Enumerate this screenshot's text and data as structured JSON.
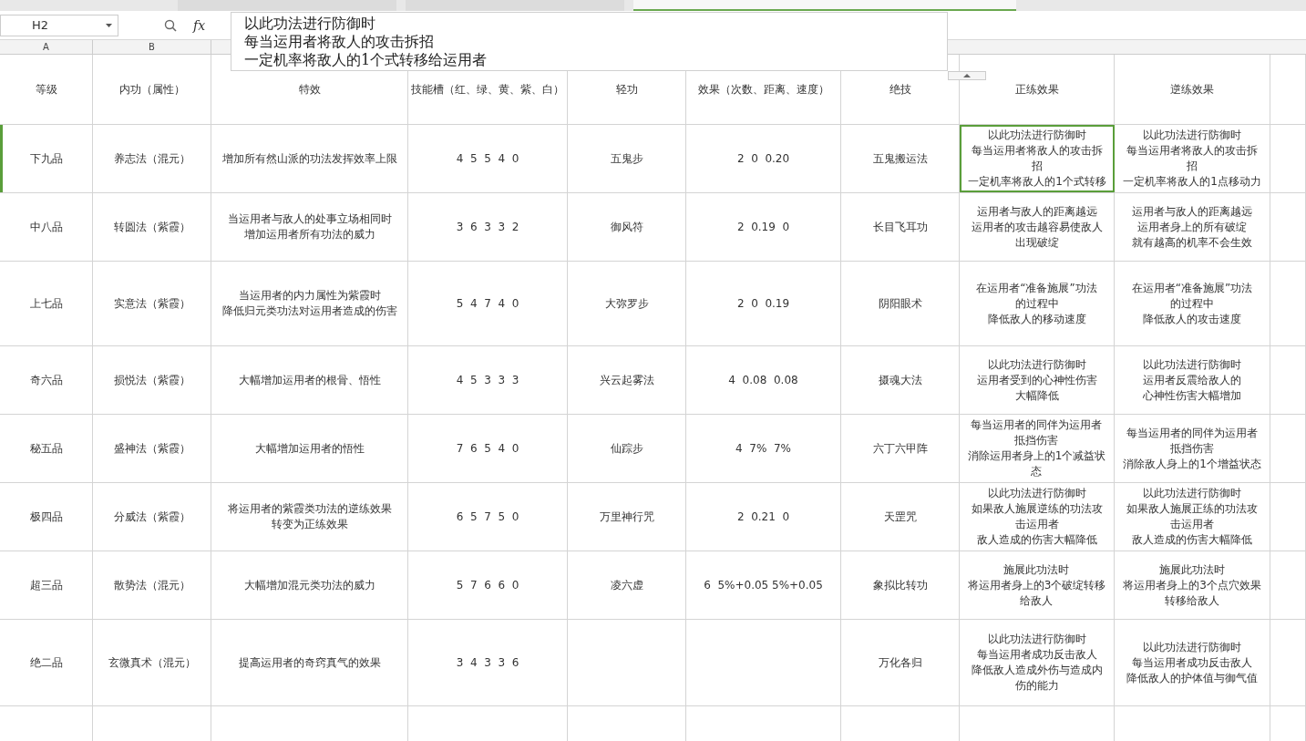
{
  "tabs": [
    {
      "selected": false
    },
    {
      "selected": false
    },
    {
      "selected": true
    }
  ],
  "formula_bar": {
    "cell_ref": "H2",
    "fx": "fx",
    "content": [
      "以此功法进行防御时",
      "每当运用者将敌人的攻击拆招",
      "一定机率将敌人的1个式转移给运用者"
    ]
  },
  "column_letters": [
    "A",
    "B"
  ],
  "headers": [
    "等级",
    "内功（属性）",
    "特效",
    "技能槽（红、绿、黄、紫、白）",
    "轻功",
    "效果（次数、距离、速度）",
    "绝技",
    "正练效果",
    "逆练效果"
  ],
  "rows": [
    {
      "selected": true,
      "cells": [
        {
          "lines": [
            "下九品"
          ],
          "selected": false
        },
        {
          "lines": [
            "养志法（混元）"
          ],
          "selected": false
        },
        {
          "lines": [
            "增加所有然山派的功法发挥效率上限"
          ],
          "selected": false
        },
        {
          "lines": [
            "4  5  5  4  0"
          ],
          "selected": false
        },
        {
          "lines": [
            "五鬼步"
          ],
          "selected": false
        },
        {
          "lines": [
            "2  0  0.20"
          ],
          "selected": false
        },
        {
          "lines": [
            "五鬼搬运法"
          ],
          "selected": false
        },
        {
          "lines": [
            "以此功法进行防御时",
            "每当运用者将敌人的攻击拆",
            "招",
            "一定机率将敌人的1个式转移"
          ],
          "selected": true
        },
        {
          "lines": [
            "以此功法进行防御时",
            "每当运用者将敌人的攻击拆",
            "招",
            "一定机率将敌人的1点移动力"
          ],
          "selected": false
        }
      ]
    },
    {
      "selected": false,
      "cells": [
        {
          "lines": [
            "中八品"
          ],
          "selected": false
        },
        {
          "lines": [
            "转圆法（紫霞）"
          ],
          "selected": false
        },
        {
          "lines": [
            "当运用者与敌人的处事立场相同时",
            "增加运用者所有功法的威力"
          ],
          "selected": false
        },
        {
          "lines": [
            "3  6  3  3  2"
          ],
          "selected": false
        },
        {
          "lines": [
            "御风符"
          ],
          "selected": false
        },
        {
          "lines": [
            "2  0.19  0"
          ],
          "selected": false
        },
        {
          "lines": [
            "长目飞耳功"
          ],
          "selected": false
        },
        {
          "lines": [
            "运用者与敌人的距离越远",
            "运用者的攻击越容易使敌人",
            "出现破绽"
          ],
          "selected": false
        },
        {
          "lines": [
            "运用者与敌人的距离越远",
            "运用者身上的所有破绽",
            "就有越高的机率不会生效"
          ],
          "selected": false
        }
      ]
    },
    {
      "selected": false,
      "cells": [
        {
          "lines": [
            "上七品"
          ],
          "selected": false
        },
        {
          "lines": [
            "实意法（紫霞）"
          ],
          "selected": false
        },
        {
          "lines": [
            "当运用者的内力属性为紫霞时",
            "降低归元类功法对运用者造成的伤害"
          ],
          "selected": false
        },
        {
          "lines": [
            "5  4  7  4  0"
          ],
          "selected": false
        },
        {
          "lines": [
            "大弥罗步"
          ],
          "selected": false
        },
        {
          "lines": [
            "2  0  0.19"
          ],
          "selected": false
        },
        {
          "lines": [
            "阴阳眼术"
          ],
          "selected": false
        },
        {
          "lines": [
            "在运用者“准备施展”功法",
            "的过程中",
            "降低敌人的移动速度"
          ],
          "selected": false
        },
        {
          "lines": [
            "在运用者“准备施展”功法",
            "的过程中",
            "降低敌人的攻击速度"
          ],
          "selected": false
        }
      ]
    },
    {
      "selected": false,
      "cells": [
        {
          "lines": [
            "奇六品"
          ],
          "selected": false
        },
        {
          "lines": [
            "损悦法（紫霞）"
          ],
          "selected": false
        },
        {
          "lines": [
            "大幅增加运用者的根骨、悟性"
          ],
          "selected": false
        },
        {
          "lines": [
            "4  5  3  3  3"
          ],
          "selected": false
        },
        {
          "lines": [
            "兴云起雾法"
          ],
          "selected": false
        },
        {
          "lines": [
            "4  0.08  0.08"
          ],
          "selected": false
        },
        {
          "lines": [
            "摄魂大法"
          ],
          "selected": false
        },
        {
          "lines": [
            "以此功法进行防御时",
            "运用者受到的心神性伤害",
            "大幅降低"
          ],
          "selected": false
        },
        {
          "lines": [
            "以此功法进行防御时",
            "运用者反震给敌人的",
            "心神性伤害大幅增加"
          ],
          "selected": false
        }
      ]
    },
    {
      "selected": false,
      "cells": [
        {
          "lines": [
            "秘五品"
          ],
          "selected": false
        },
        {
          "lines": [
            "盛神法（紫霞）"
          ],
          "selected": false
        },
        {
          "lines": [
            "大幅增加运用者的悟性"
          ],
          "selected": false
        },
        {
          "lines": [
            "7  6  5  4  0"
          ],
          "selected": false
        },
        {
          "lines": [
            "仙踪步"
          ],
          "selected": false
        },
        {
          "lines": [
            "4  7%  7%"
          ],
          "selected": false
        },
        {
          "lines": [
            "六丁六甲阵"
          ],
          "selected": false
        },
        {
          "lines": [
            "每当运用者的同伴为运用者",
            "抵挡伤害",
            "消除运用者身上的1个减益状",
            "态"
          ],
          "selected": false
        },
        {
          "lines": [
            "每当运用者的同伴为运用者",
            "抵挡伤害",
            "消除敌人身上的1个增益状态"
          ],
          "selected": false
        }
      ]
    },
    {
      "selected": false,
      "cells": [
        {
          "lines": [
            "极四品"
          ],
          "selected": false
        },
        {
          "lines": [
            "分威法（紫霞）"
          ],
          "selected": false
        },
        {
          "lines": [
            "将运用者的紫霞类功法的逆练效果",
            "转变为正练效果"
          ],
          "selected": false
        },
        {
          "lines": [
            "6  5  7  5  0"
          ],
          "selected": false
        },
        {
          "lines": [
            "万里神行咒"
          ],
          "selected": false
        },
        {
          "lines": [
            "2  0.21  0"
          ],
          "selected": false
        },
        {
          "lines": [
            "天罡咒"
          ],
          "selected": false
        },
        {
          "lines": [
            "以此功法进行防御时",
            "如果敌人施展逆练的功法攻",
            "击运用者",
            "敌人造成的伤害大幅降低"
          ],
          "selected": false
        },
        {
          "lines": [
            "以此功法进行防御时",
            "如果敌人施展正练的功法攻",
            "击运用者",
            "敌人造成的伤害大幅降低"
          ],
          "selected": false
        }
      ]
    },
    {
      "selected": false,
      "cells": [
        {
          "lines": [
            "超三品"
          ],
          "selected": false
        },
        {
          "lines": [
            "散势法（混元）"
          ],
          "selected": false
        },
        {
          "lines": [
            "大幅增加混元类功法的威力"
          ],
          "selected": false
        },
        {
          "lines": [
            "5  7  6  6  0"
          ],
          "selected": false
        },
        {
          "lines": [
            "凌六虚"
          ],
          "selected": false
        },
        {
          "lines": [
            "6  5%+0.05 5%+0.05"
          ],
          "selected": false
        },
        {
          "lines": [
            "象拟比转功"
          ],
          "selected": false
        },
        {
          "lines": [
            "施展此功法时",
            "将运用者身上的3个破绽转移",
            "给敌人"
          ],
          "selected": false
        },
        {
          "lines": [
            "施展此功法时",
            "将运用者身上的3个点穴效果",
            "转移给敌人"
          ],
          "selected": false
        }
      ]
    },
    {
      "selected": false,
      "cells": [
        {
          "lines": [
            "绝二品"
          ],
          "selected": false
        },
        {
          "lines": [
            "玄微真术（混元）"
          ],
          "selected": false
        },
        {
          "lines": [
            "提高运用者的奇窍真气的效果"
          ],
          "selected": false
        },
        {
          "lines": [
            "3  4  3  3  6"
          ],
          "selected": false
        },
        {
          "selected": false
        },
        {
          "selected": false
        },
        {
          "lines": [
            "万化各归"
          ],
          "selected": false
        },
        {
          "lines": [
            "以此功法进行防御时",
            "每当运用者成功反击敌人",
            "降低敌人造成外伤与造成内",
            "伤的能力"
          ],
          "selected": false
        },
        {
          "lines": [
            "以此功法进行防御时",
            "每当运用者成功反击敌人",
            "降低敌人的护体值与御气值"
          ],
          "selected": false
        }
      ]
    }
  ]
}
